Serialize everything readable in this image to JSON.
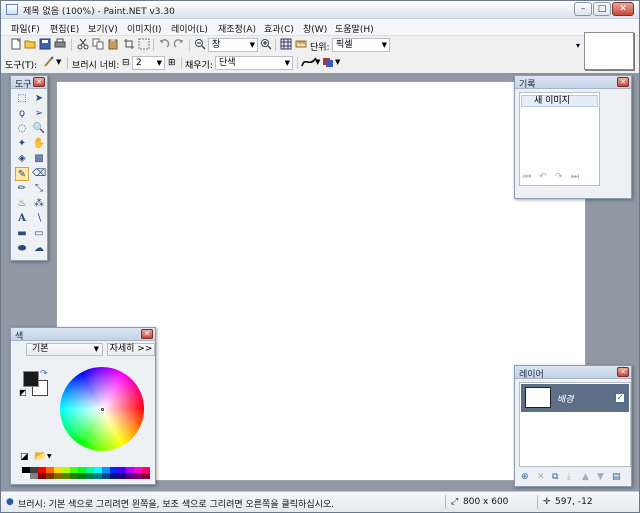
{
  "window": {
    "title": "제목 없음 (100%) - Paint.NET v3.30",
    "min": "–",
    "max": "□",
    "close": "✕"
  },
  "menu": [
    "파일(F)",
    "편집(E)",
    "보기(V)",
    "이미지(I)",
    "레이어(L)",
    "재조정(A)",
    "효과(C)",
    "창(W)",
    "도움말(H)"
  ],
  "toolbar1": {
    "zoom_value": "창",
    "units_label": "단위:",
    "units_value": "픽셀"
  },
  "toolbar2": {
    "tool_label": "도구(T):",
    "brush_width_label": "브러시 너비:",
    "brush_width_minus": "⊟",
    "brush_width_value": "2",
    "brush_width_plus": "⊞",
    "fill_label": "채우기:",
    "fill_value": "단색"
  },
  "tools_panel": {
    "title": "도구",
    "close": "✕"
  },
  "history_panel": {
    "title": "기록",
    "close": "✕",
    "items": [
      "새 이미지"
    ]
  },
  "layers_panel": {
    "title": "레이어",
    "close": "✕",
    "layers": [
      {
        "name": "배경",
        "visible": "✓"
      }
    ]
  },
  "colors_panel": {
    "title": "색",
    "close": "✕",
    "palette_mode": "기본",
    "more_label": "자세히 >>"
  },
  "status": {
    "hint": "브러시: 기본 색으로 그리려면 왼쪽을, 보조 색으로 그리려면 오른쪽을 클릭하십시오.",
    "image_size": "800 x 600",
    "cursor_pos": "597, -12"
  },
  "colors": {
    "accent": "#c7463a",
    "panel_title": "#c3d2e6",
    "workspace": "#8f98a3",
    "layer_selected": "#5d6f86"
  }
}
